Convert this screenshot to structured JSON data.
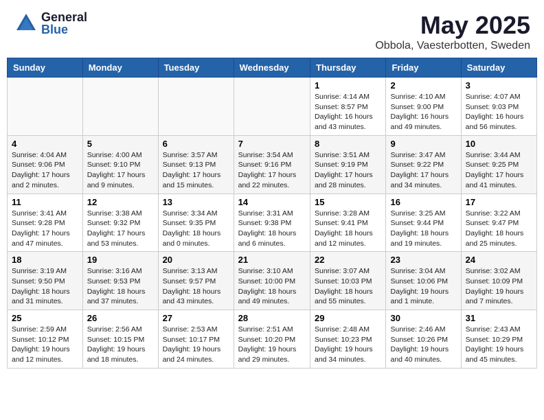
{
  "header": {
    "logo_general": "General",
    "logo_blue": "Blue",
    "title": "May 2025",
    "location": "Obbola, Vaesterbotten, Sweden"
  },
  "calendar": {
    "days_of_week": [
      "Sunday",
      "Monday",
      "Tuesday",
      "Wednesday",
      "Thursday",
      "Friday",
      "Saturday"
    ],
    "weeks": [
      [
        {
          "day": "",
          "empty": true
        },
        {
          "day": "",
          "empty": true
        },
        {
          "day": "",
          "empty": true
        },
        {
          "day": "",
          "empty": true
        },
        {
          "day": "1",
          "info": "Sunrise: 4:14 AM\nSunset: 8:57 PM\nDaylight: 16 hours\nand 43 minutes."
        },
        {
          "day": "2",
          "info": "Sunrise: 4:10 AM\nSunset: 9:00 PM\nDaylight: 16 hours\nand 49 minutes."
        },
        {
          "day": "3",
          "info": "Sunrise: 4:07 AM\nSunset: 9:03 PM\nDaylight: 16 hours\nand 56 minutes."
        }
      ],
      [
        {
          "day": "4",
          "info": "Sunrise: 4:04 AM\nSunset: 9:06 PM\nDaylight: 17 hours\nand 2 minutes."
        },
        {
          "day": "5",
          "info": "Sunrise: 4:00 AM\nSunset: 9:10 PM\nDaylight: 17 hours\nand 9 minutes."
        },
        {
          "day": "6",
          "info": "Sunrise: 3:57 AM\nSunset: 9:13 PM\nDaylight: 17 hours\nand 15 minutes."
        },
        {
          "day": "7",
          "info": "Sunrise: 3:54 AM\nSunset: 9:16 PM\nDaylight: 17 hours\nand 22 minutes."
        },
        {
          "day": "8",
          "info": "Sunrise: 3:51 AM\nSunset: 9:19 PM\nDaylight: 17 hours\nand 28 minutes."
        },
        {
          "day": "9",
          "info": "Sunrise: 3:47 AM\nSunset: 9:22 PM\nDaylight: 17 hours\nand 34 minutes."
        },
        {
          "day": "10",
          "info": "Sunrise: 3:44 AM\nSunset: 9:25 PM\nDaylight: 17 hours\nand 41 minutes."
        }
      ],
      [
        {
          "day": "11",
          "info": "Sunrise: 3:41 AM\nSunset: 9:28 PM\nDaylight: 17 hours\nand 47 minutes."
        },
        {
          "day": "12",
          "info": "Sunrise: 3:38 AM\nSunset: 9:32 PM\nDaylight: 17 hours\nand 53 minutes."
        },
        {
          "day": "13",
          "info": "Sunrise: 3:34 AM\nSunset: 9:35 PM\nDaylight: 18 hours\nand 0 minutes."
        },
        {
          "day": "14",
          "info": "Sunrise: 3:31 AM\nSunset: 9:38 PM\nDaylight: 18 hours\nand 6 minutes."
        },
        {
          "day": "15",
          "info": "Sunrise: 3:28 AM\nSunset: 9:41 PM\nDaylight: 18 hours\nand 12 minutes."
        },
        {
          "day": "16",
          "info": "Sunrise: 3:25 AM\nSunset: 9:44 PM\nDaylight: 18 hours\nand 19 minutes."
        },
        {
          "day": "17",
          "info": "Sunrise: 3:22 AM\nSunset: 9:47 PM\nDaylight: 18 hours\nand 25 minutes."
        }
      ],
      [
        {
          "day": "18",
          "info": "Sunrise: 3:19 AM\nSunset: 9:50 PM\nDaylight: 18 hours\nand 31 minutes."
        },
        {
          "day": "19",
          "info": "Sunrise: 3:16 AM\nSunset: 9:53 PM\nDaylight: 18 hours\nand 37 minutes."
        },
        {
          "day": "20",
          "info": "Sunrise: 3:13 AM\nSunset: 9:57 PM\nDaylight: 18 hours\nand 43 minutes."
        },
        {
          "day": "21",
          "info": "Sunrise: 3:10 AM\nSunset: 10:00 PM\nDaylight: 18 hours\nand 49 minutes."
        },
        {
          "day": "22",
          "info": "Sunrise: 3:07 AM\nSunset: 10:03 PM\nDaylight: 18 hours\nand 55 minutes."
        },
        {
          "day": "23",
          "info": "Sunrise: 3:04 AM\nSunset: 10:06 PM\nDaylight: 19 hours\nand 1 minute."
        },
        {
          "day": "24",
          "info": "Sunrise: 3:02 AM\nSunset: 10:09 PM\nDaylight: 19 hours\nand 7 minutes."
        }
      ],
      [
        {
          "day": "25",
          "info": "Sunrise: 2:59 AM\nSunset: 10:12 PM\nDaylight: 19 hours\nand 12 minutes."
        },
        {
          "day": "26",
          "info": "Sunrise: 2:56 AM\nSunset: 10:15 PM\nDaylight: 19 hours\nand 18 minutes."
        },
        {
          "day": "27",
          "info": "Sunrise: 2:53 AM\nSunset: 10:17 PM\nDaylight: 19 hours\nand 24 minutes."
        },
        {
          "day": "28",
          "info": "Sunrise: 2:51 AM\nSunset: 10:20 PM\nDaylight: 19 hours\nand 29 minutes."
        },
        {
          "day": "29",
          "info": "Sunrise: 2:48 AM\nSunset: 10:23 PM\nDaylight: 19 hours\nand 34 minutes."
        },
        {
          "day": "30",
          "info": "Sunrise: 2:46 AM\nSunset: 10:26 PM\nDaylight: 19 hours\nand 40 minutes."
        },
        {
          "day": "31",
          "info": "Sunrise: 2:43 AM\nSunset: 10:29 PM\nDaylight: 19 hours\nand 45 minutes."
        }
      ]
    ]
  }
}
